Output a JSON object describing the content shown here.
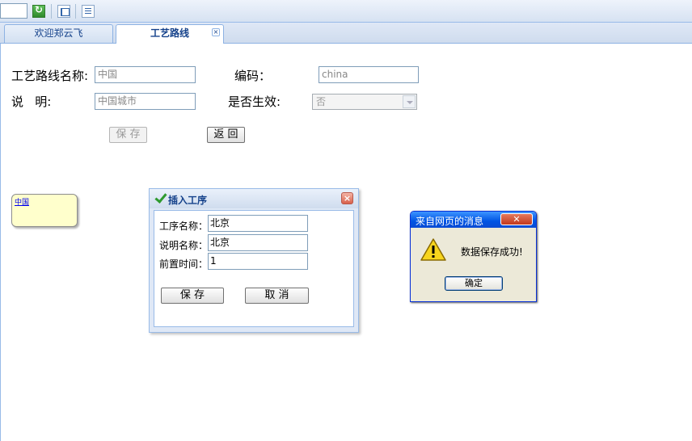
{
  "toolbar": {
    "icons": [
      "refresh-icon",
      "tree-icon",
      "list-icon"
    ]
  },
  "tabs": [
    {
      "label": "欢迎郑云飞"
    },
    {
      "label": "工艺路线",
      "close": "×"
    }
  ],
  "form": {
    "name_label": "工艺路线名称:",
    "name_value": "中国",
    "code_label": "编码：",
    "code_value": "china",
    "desc_label": "说   明:",
    "desc_value": "中国城市",
    "active_label": "是否生效:",
    "active_value": "否",
    "save_label": "保 存",
    "back_label": "返 回"
  },
  "node": {
    "label": "中国"
  },
  "insert_dialog": {
    "title": "插入工序",
    "close": "×",
    "process_name_label": "工序名称：",
    "process_name_value": "北京",
    "desc_name_label": "说明名称：",
    "desc_name_value": "北京",
    "lead_time_label": "前置时间：",
    "lead_time_value": "1",
    "save_label": "保   存",
    "cancel_label": "取   消"
  },
  "alert": {
    "title": "来自网页的消息",
    "close": "✕",
    "message": "数据保存成功!",
    "ok_label": "确定"
  },
  "colors": {
    "accent": "#15428b",
    "panel_border": "#99bbe8",
    "node_fill": "#ffffcc",
    "alert_title_bar": "#0054e3"
  }
}
